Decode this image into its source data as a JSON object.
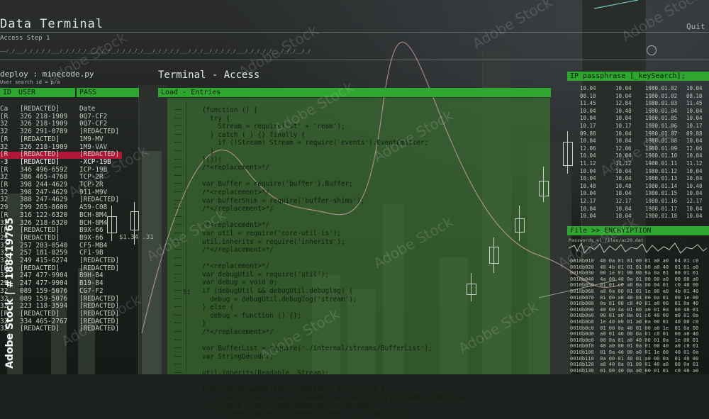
{
  "app": {
    "title": "Data Terminal",
    "subtitle": "Access Step 1",
    "quit_label": "Quit",
    "scroll_text": "——/_/___/_/_/_/_/___/_/_/_/_/___/_/_/__/_/_/_/_/___/_/_/_/_/___/_/_/__/_/_/_/_/___/_/_/_/_/___/_/_/__/_/"
  },
  "left_panel": {
    "title": "deploy : minecode.py",
    "search_hint": "User search id = p/a",
    "headers": [
      "ID",
      "USER",
      "PASS"
    ],
    "rows": [
      [
        "Ca",
        "[REDACTED]",
        "Date"
      ],
      [
        "[R",
        "326 218-1909",
        "0Q7-CF2"
      ],
      [
        "32",
        "326 218-1909",
        "0Q7-CF2"
      ],
      [
        "32",
        "326 291-0789",
        "[REDACTED]"
      ],
      [
        "[R",
        "[REDACTED]",
        "1M9-MV"
      ],
      [
        "32",
        "326 218-1909",
        "1M9-VAV"
      ],
      [
        "[R",
        "[REDACTED]",
        "[REDACTED]"
      ],
      [
        "-3",
        "[REDACTED]",
        "-XCP-19B"
      ],
      [
        "[R",
        "346 496-6592",
        "ICP-19B"
      ],
      [
        "32",
        "386 465-4768",
        "TCP-2R"
      ],
      [
        "[R",
        "398 244-4629",
        "TCP-2R"
      ],
      [
        "32",
        "398 247-4629",
        "911-M9V"
      ],
      [
        "32",
        "388 247-4629",
        "[REDACTED]"
      ],
      [
        "29",
        "299 265-8600",
        "A59-C08"
      ],
      [
        "[R",
        "316 122-6320",
        "BCH-8M4"
      ],
      [
        "32",
        "326 218-6320",
        "BCH-8M4"
      ],
      [
        "[R",
        "[REDACTED]",
        "B9X-66"
      ],
      [
        "29",
        "[REDACTED]",
        "B9X-66"
      ],
      [
        "32",
        "257 283-0540",
        "CF5-MB4"
      ],
      [
        "32",
        "257 181-8259",
        "CF1-9B"
      ],
      [
        "32",
        "249 415-6274",
        "[REDACTED]"
      ],
      [
        "[R",
        "[REDACTED]",
        "[REDACTED]"
      ],
      [
        "32",
        "247 477-9904",
        "B9H-B4"
      ],
      [
        "29",
        "247 477-9904",
        "B19-B4"
      ],
      [
        "32",
        "089 159-5076",
        "CG7-F2"
      ],
      [
        "32",
        "089 159-5076",
        "[REDACTED]"
      ],
      [
        "32",
        "223 118-3594",
        "[REDACTED]"
      ],
      [
        "[R",
        "[REDACTED]",
        "[REDACTED]"
      ],
      [
        "32",
        "334 465-2767",
        "[REDACTED]"
      ],
      [
        "32",
        "[REDACTED]",
        "[REDACTED]"
      ]
    ],
    "highlight_row": 7,
    "price_label": "$1.34 .31"
  },
  "center_panel": {
    "title": "Terminal - Access",
    "header": "Load - Entries",
    "code_lines": [
      "(function () {",
      "  try {",
      "    Stream = require('st' + 'ream');",
      "  } catch (_) {} finally {",
      "    if (!Stream) Stream = require('events').EventEmitter;",
      "  }",
      "}())(",
      "/*<replacement>*/",
      "",
      "var Buffer = require('buffer').Buffer;",
      "/*<replacement>*/",
      "var bufferShim = require('buffer-shims');",
      "/*</replacement>*/",
      "",
      "/*<replacement>*/",
      "var util = require('core-util-is');",
      "util.inherits = require('inherits');",
      "/*</replacement>*/",
      "",
      "/*<replacement>*/",
      "var debugUtil = require('util');",
      "var debug = void 0;",
      "if (debugUtil && debugUtil.debuglog) {",
      "  debug = debugUtil.debuglog('stream');",
      "} else {",
      "  debug = function () {};",
      "}",
      "/*</replacement>*/",
      "",
      "var BufferList = require('./internal/streams/BufferList');",
      "var StringDecoder;",
      "",
      "util.inherits(Readable, Stream);",
      "",
      "function prependListener(emitter, event, fn) {",
      "  // Sadly this is not cacheable as some libraries bundle their own",
      "  // event emitter implementation with them.",
      "  if (typeof emitter.prependListener === 'function') {"
    ],
    "side_number": "51"
  },
  "right_panel": {
    "header_top": "IP passphrase [_keySearch];",
    "table_rows": [
      [
        "10.04",
        "10.04",
        "1980.01.02",
        "10.04"
      ],
      [
        "08.10",
        "10.04",
        "1980.01.02",
        "08.10"
      ],
      [
        "11.45",
        "12.84",
        "1980.01.03",
        "11.45"
      ],
      [
        "10.04",
        "10.48",
        "1980.01.04",
        "10.04"
      ],
      [
        "10.04",
        "10.04",
        "1980.01.05",
        "10.04"
      ],
      [
        "10.17",
        "10.17",
        "1980.01.06",
        "10.17"
      ],
      [
        "09.88",
        "10.04",
        "1980.01.07",
        "09.88"
      ],
      [
        "10.04",
        "10.04",
        "1980.01.08",
        "10.04"
      ],
      [
        "12.06",
        "12.06",
        "1980.01.09",
        "12.06"
      ],
      [
        "10.04",
        "10.04",
        "1980.01.10",
        "10.04"
      ],
      [
        "11.12",
        "11.12",
        "1980.01.11",
        "11.12"
      ],
      [
        "10.04",
        "10.04",
        "1980.01.12",
        "10.04"
      ],
      [
        "10.04",
        "10.04",
        "1980.01.13",
        "10.04"
      ],
      [
        "10.48",
        "10.48",
        "1980.01.14",
        "10.48"
      ],
      [
        "10.04",
        "10.04",
        "1980.01.15",
        "10.04"
      ],
      [
        "12.17",
        "12.17",
        "1980.01.16",
        "12.17"
      ],
      [
        "10.04",
        "10.04",
        "1980.01.17",
        "10.04"
      ],
      [
        "10.04",
        "10.04",
        "1980.01.18",
        "10.04"
      ]
    ],
    "header_bottom": "File >> ENCRYIPTION",
    "encrypt_sub": "Passwords_el_files/ac20.dat",
    "hex_rows": [
      "0010b010  40 0a 01 01 00 01 a0 a0  04 01 c0",
      "0010b020  40 4b 01 01 01 00 a0 40  01 01 a0",
      "0010b030  00 1e 01 00 00 0a 0a 01  00 01 01",
      "0010b040  4a 00 40 0a 01 00 00 a0  00 00 a0",
      "0010b050  01 01 c0 a0 0a 00 04 01  c0 40 00",
      "0010b060  a0 0a 00 01 01 1e 00 a0  4b 01 40",
      "0010b070  01 00 a0 40 04 00 0a 01  00 1e 00",
      "0010b080  0a 01 00 c0 40 01 a0 00  01 0a 40",
      "0010b090  40 00 4a 01 00 a0 01 0a  00 40 01",
      "0010b0a0  00 01 a0 0a 01 c0 40 00  a0 01 0a",
      "0010b0b0  1e 40 00 01 a0 0a 00 01  40 00 c0",
      "0010b0c0  01 00 0a 40 01 00 a0 1e  01 0a 00",
      "0010b0d0  a0 01 40 00 0a 01 c0 01  00 a0 40",
      "0010b0e0  00 0a 01 a0 40 00 01 0a  1e 00 01",
      "0010b0f0  40 a0 00 01 0a 01 00 40  a0 c0 01",
      "0010b100  01 0a 40 00 a0 01 1e 00  40 01 0a",
      "0010b110  0a 00 01 40 01 a0 00 0a  01 40 00",
      "0010b120  a0 40 0a 01 00 01 40 a0  00 0a 01",
      "0010b130  01 00 40 0a a0 00 01 01  c0 40 a0"
    ]
  },
  "watermark": {
    "text": "Adobe Stock",
    "side_credit": "Adobe Stock | #188419765"
  },
  "colors": {
    "accent_green": "#2fa62f",
    "panel_green": "#3c6e32",
    "highlight_red": "#b01737"
  }
}
